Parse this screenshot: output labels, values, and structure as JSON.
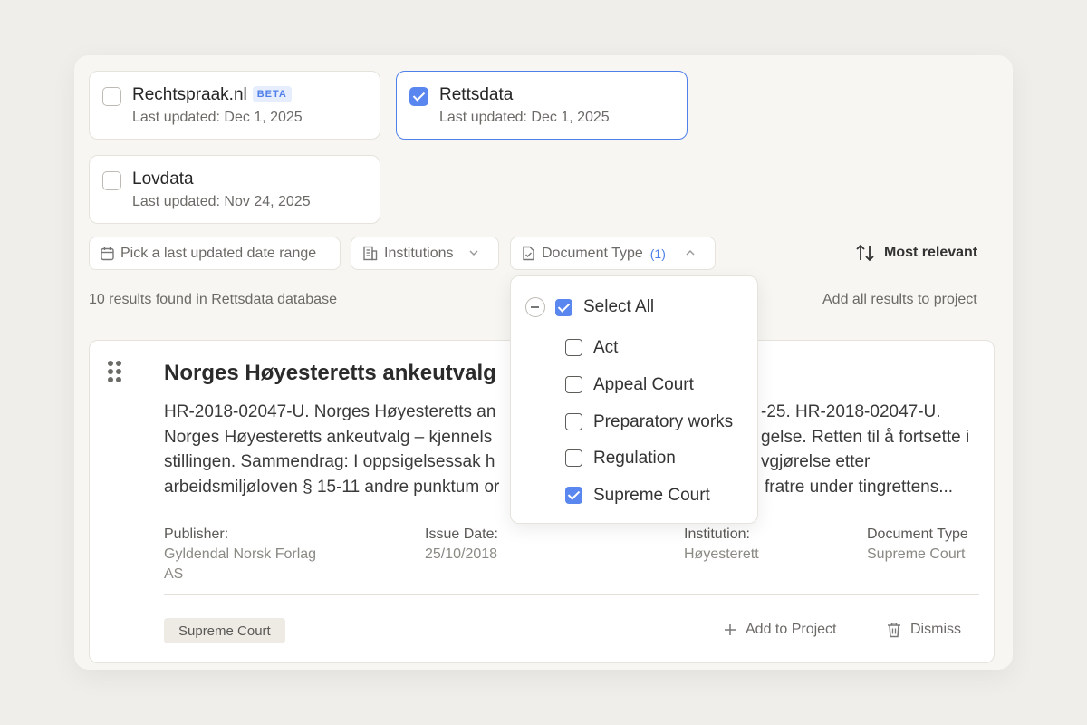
{
  "sources": [
    {
      "name": "Rechtspraak.nl",
      "badge": "BETA",
      "updated": "Last updated: Dec 1, 2025",
      "checked": false
    },
    {
      "name": "Rettsdata",
      "updated": "Last updated: Dec 1, 2025",
      "checked": true
    },
    {
      "name": "Lovdata",
      "updated": "Last updated: Nov 24, 2025",
      "checked": false
    }
  ],
  "filters": {
    "date_range": "Pick a last updated date range",
    "institutions": "Institutions",
    "document_type": "Document Type",
    "document_type_count": "(1)",
    "sort_label": "Most relevant"
  },
  "results_bar": {
    "count_text": "10 results found in Rettsdata database",
    "add_all": "Add all results to project"
  },
  "result": {
    "title": "Norges Høyesteretts ankeutvalg",
    "line1_a": "HR-2018-02047-U. Norges Høyesteretts an",
    "line1_b": "-25. HR-2018-02047-U.",
    "line2_a": "Norges Høyesteretts ankeutvalg – kjennels",
    "line2_b": "gelse. Retten til å fortsette i",
    "line3_a": "stillingen. Sammendrag: I oppsigelsessak h",
    "line3_b": "vgjørelse etter",
    "line4_a": "arbeidsmiljøloven § 15-11 andre punktum or",
    "line4_b": "fratre under tingrettens...",
    "publisher_label": "Publisher:",
    "publisher_line1": "Gyldendal Norsk Forlag",
    "publisher_line2": "AS",
    "issue_label": "Issue Date:",
    "issue_value": "25/10/2018",
    "institution_label": "Institution:",
    "institution_value": "Høyesterett",
    "doctype_label": "Document Type",
    "doctype_value": "Supreme Court",
    "tag": "Supreme Court",
    "add_to_project": "Add to Project",
    "dismiss": "Dismiss"
  },
  "dropdown": {
    "select_all": "Select All",
    "options": [
      {
        "label": "Act",
        "checked": false
      },
      {
        "label": "Appeal Court",
        "checked": false
      },
      {
        "label": "Preparatory works",
        "checked": false
      },
      {
        "label": "Regulation",
        "checked": false
      },
      {
        "label": "Supreme Court",
        "checked": true
      }
    ]
  },
  "colors": {
    "accent": "#5a86ef",
    "background": "#efeeea",
    "panel": "#f7f6f2"
  }
}
